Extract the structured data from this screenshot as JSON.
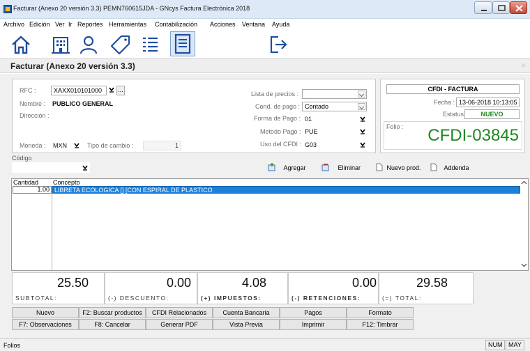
{
  "window": {
    "title": "Facturar (Anexo 20 versión 3.3) PEMN760615JDA - GNcys Factura Electrónica 2018"
  },
  "menu": [
    "Archivo",
    "Edición",
    "Ver",
    "Ir",
    "Reportes",
    "Herramientas",
    "Contabilización",
    "Acciones",
    "Ventana",
    "Ayuda"
  ],
  "toolbar_icons": [
    "home-icon",
    "building-icon",
    "user-icon",
    "tag-icon",
    "list-icon",
    "document-icon",
    "exit-icon"
  ],
  "module": {
    "title": "Facturar (Anexo 20 versión 3.3)",
    "close": "×"
  },
  "client": {
    "rfc_label": "RFC :",
    "rfc_value": "XAXX010101000",
    "lookup_button": "...",
    "name_label": "Nombre :",
    "name_value": "PUBLICO GENERAL",
    "address_label": "Dirección :",
    "currency_label": "Moneda :",
    "currency_value": "MXN",
    "exchange_label": "Tipo de cambio :",
    "exchange_value": "1"
  },
  "terms": {
    "price_list_label": "Lista de precios :",
    "price_list_value": "",
    "payment_cond_label": "Cond. de pago :",
    "payment_cond_value": "Contado",
    "payment_form_label": "Forma de Pago :",
    "payment_form_value": "01",
    "payment_method_label": "Metodo Pago :",
    "payment_method_value": "PUE",
    "cfdi_use_label": "Uso del CFDI :",
    "cfdi_use_value": "G03"
  },
  "invoice": {
    "type": "CFDI - FACTURA",
    "date_label": "Fecha :",
    "date_value": "13-06-2018 10:13:05",
    "status_label": "Estatus :",
    "status_value": "NUEVO",
    "folio_label": "Folio :",
    "folio_value": "CFDI-03845",
    "accent_color": "#1f8a1f"
  },
  "code": {
    "label": "Código",
    "value": ""
  },
  "actions": {
    "add": "Agregar",
    "delete": "Eliminar",
    "new_product": "Nuevo prod.",
    "addenda": "Addenda"
  },
  "grid": {
    "headers": [
      "Cantidad",
      "Concepto"
    ],
    "rows": [
      {
        "qty": "1.00",
        "concept": "LIBRETA ECOLOGICA [] [CON ESPIRAL DE PLASTICO"
      }
    ]
  },
  "totals": {
    "subtotal_value": "25.50",
    "subtotal_label": "SUBTOTAL:",
    "discount_value": "0.00",
    "discount_label": "(-) DESCUENTO:",
    "taxes_value": "4.08",
    "taxes_label": "(+) IMPUESTOS:",
    "withholding_value": "0.00",
    "withholding_label": "(-) RETENCIONES:",
    "total_value": "29.58",
    "total_label": "(=) TOTAL:"
  },
  "buttons": {
    "row1": [
      "Nuevo",
      "F2: Buscar productos",
      "CFDI Relacionados",
      "Cuenta Bancaria",
      "Pagos",
      "Formato"
    ],
    "row2": [
      "F7: Observaciones",
      "F8: Cancelar",
      "Generar PDF",
      "Vista Previa",
      "Imprimir",
      "F12: Timbrar"
    ]
  },
  "statusbar": {
    "text": "Folios",
    "num": "NUM",
    "caps": "MAY"
  }
}
